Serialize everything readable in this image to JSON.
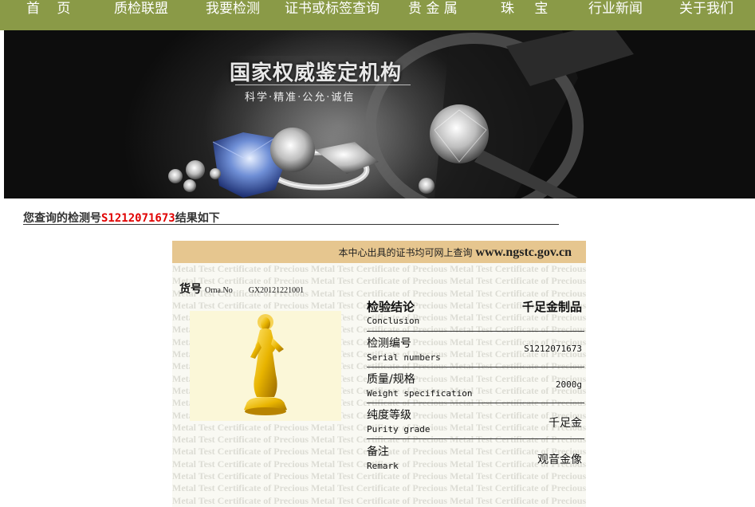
{
  "nav": {
    "items": [
      "首 页",
      "质检联盟",
      "我要检测",
      "证书或标签查询",
      "贵 金 属",
      "珠 宝",
      "行业新闻",
      "关于我们"
    ]
  },
  "banner": {
    "title": "国家权威鉴定机构",
    "subtitle": "科学·精准·公允·诚信"
  },
  "result": {
    "prefix": "您查询的检测号",
    "number": "S1212071673",
    "suffix": "结果如下"
  },
  "certificate": {
    "header_text": "本中心出具的证书均可网上查询",
    "header_url": "www.ngstc.gov.cn",
    "watermark": "Metal Test Certificate of Precious Metal Test Certificate of Precious Metal Test Certificate of Precious Metal Test Certificate",
    "orn_label_cn": "货号",
    "orn_label_en": "Orna.No",
    "orn_value": "GX20121221001",
    "rows": [
      {
        "cn": "检验结论",
        "en": "Conclusion",
        "value": "千足金制品"
      },
      {
        "cn": "检测编号",
        "en": "Serial numbers",
        "value": "S1212071673"
      },
      {
        "cn": "质量/规格",
        "en": "Weight specification",
        "value": "2000g"
      },
      {
        "cn": "纯度等级",
        "en": "Purity grade",
        "value": "千足金"
      },
      {
        "cn": "备注",
        "en": "Remark",
        "value": "观音金像"
      }
    ]
  },
  "colors": {
    "nav_bg": "#8a9a47",
    "cert_header": "#e6c68f",
    "highlight": "#e10000"
  }
}
